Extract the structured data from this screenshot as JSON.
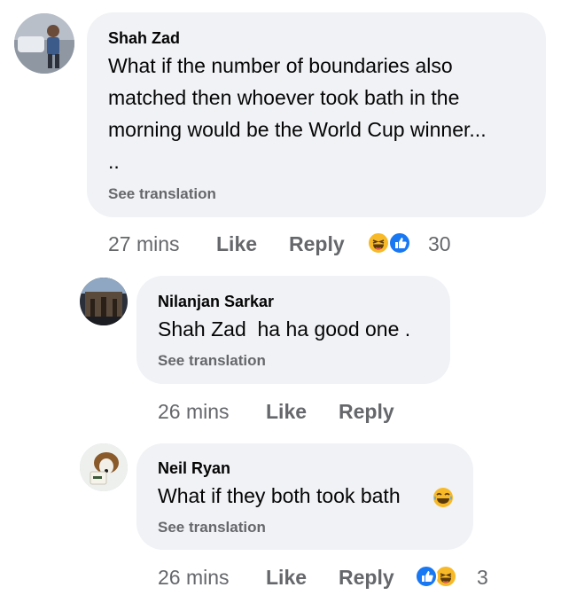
{
  "comments": [
    {
      "author": "Shah Zad",
      "text_lines": [
        "What if the number of boundaries also",
        "matched then whoever took bath in the",
        "morning would be the World Cup winner...",
        ".."
      ],
      "translate": "See translation",
      "time": "27 mins",
      "like": "Like",
      "reply": "Reply",
      "reactions": [
        "haha",
        "like"
      ],
      "reaction_count": "30"
    },
    {
      "author": "Nilanjan Sarkar",
      "text": "Shah Zad  ha ha good one .",
      "translate": "See translation",
      "time": "26 mins",
      "like": "Like",
      "reply": "Reply"
    },
    {
      "author": "Neil Ryan",
      "text": "What if they both took bath",
      "text_emoji": "laughing-tears-emoji",
      "translate": "See translation",
      "time": "26 mins",
      "like": "Like",
      "reply": "Reply",
      "reactions": [
        "like",
        "haha"
      ],
      "reaction_count": "3"
    }
  ],
  "colors": {
    "bubble": "#f0f2f5",
    "meta": "#65676b",
    "like_reaction": "#1877f2",
    "haha_reaction": "#f7b928"
  }
}
